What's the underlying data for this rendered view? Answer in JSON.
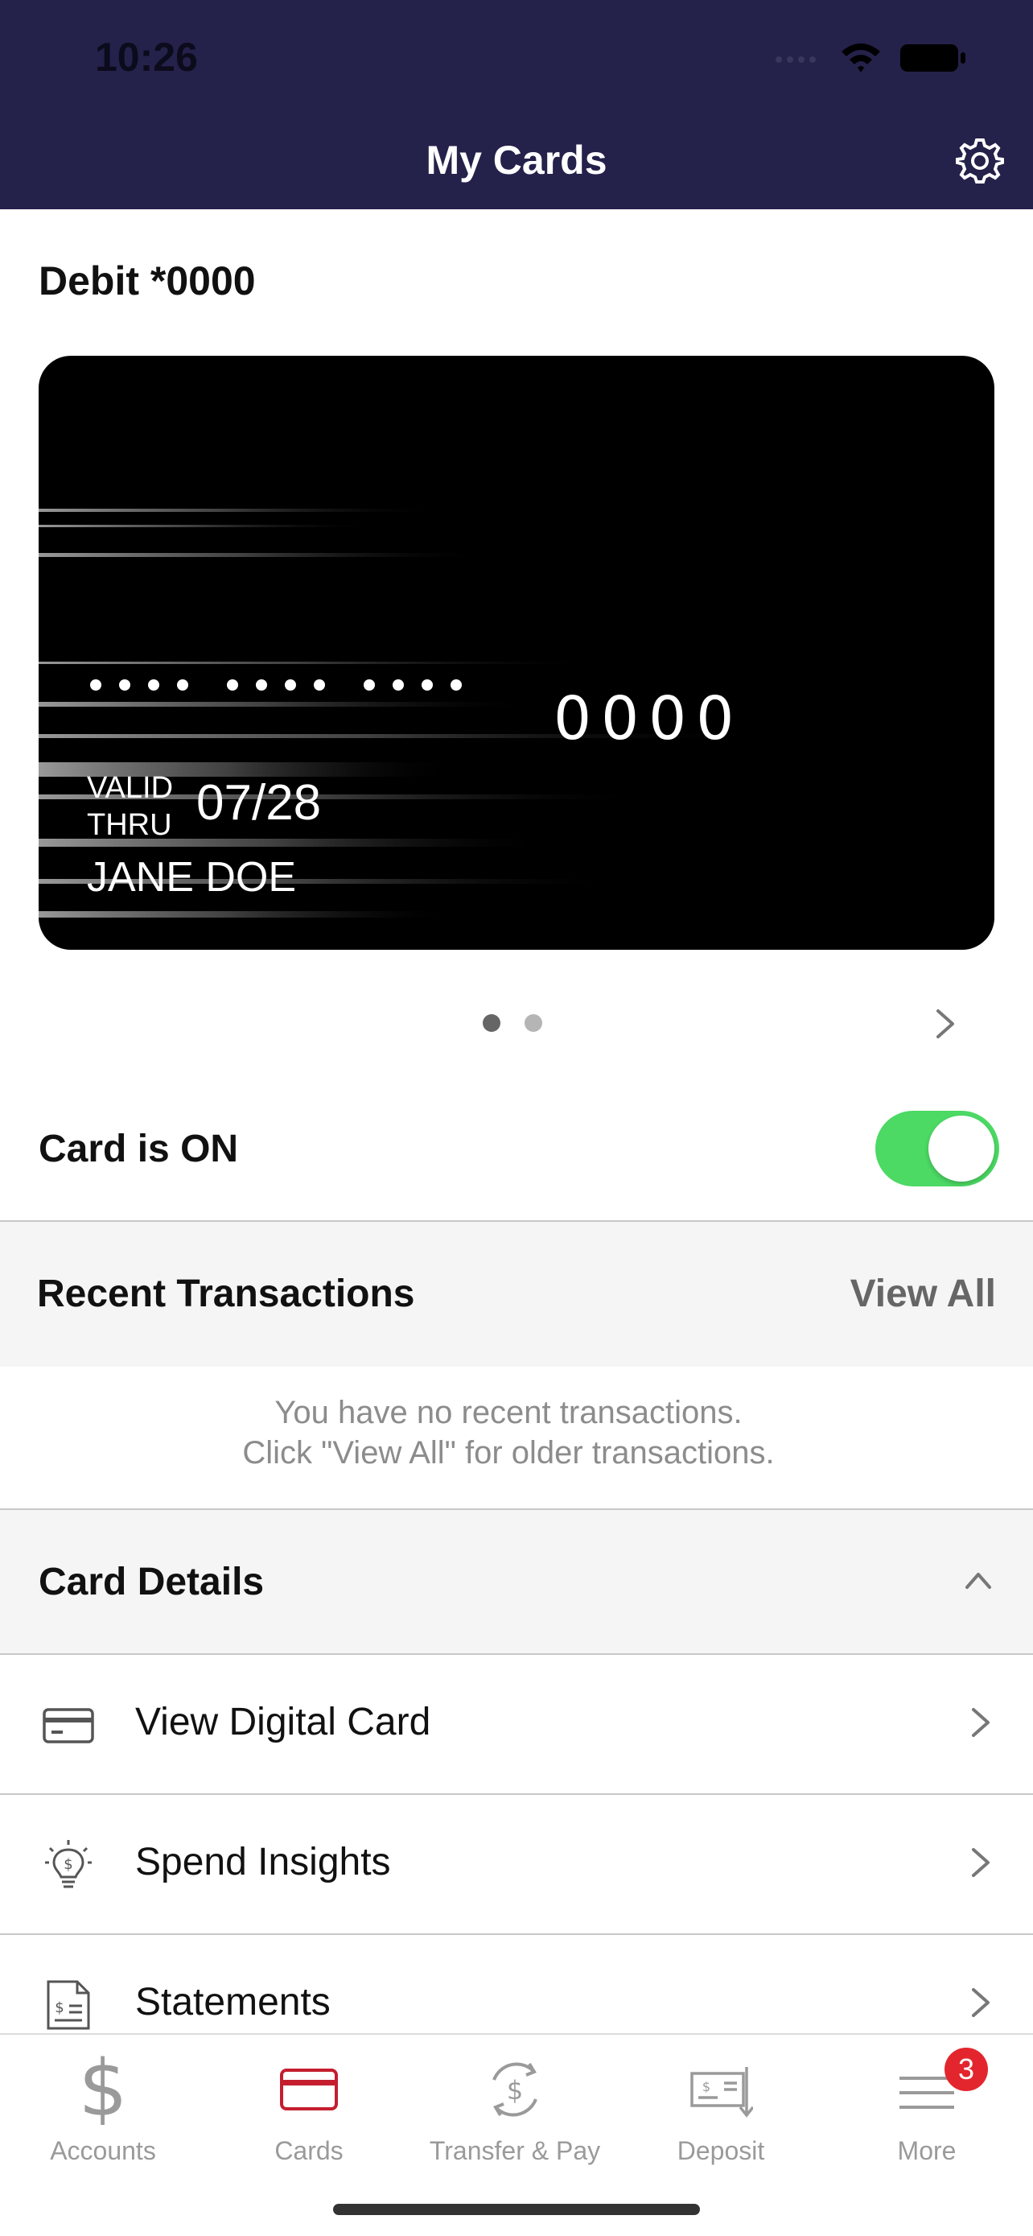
{
  "status_bar": {
    "time": "10:26"
  },
  "header": {
    "title": "My Cards"
  },
  "card": {
    "label": "Debit *0000",
    "last4": "0000",
    "valid_line1": "VALID",
    "valid_line2": "THRU",
    "expiry": "07/28",
    "holder": "JANE DOE",
    "page_count": 2,
    "active_page": 1
  },
  "card_toggle": {
    "label": "Card is ON",
    "on": true
  },
  "transactions": {
    "title": "Recent Transactions",
    "view_all": "View All",
    "empty_line1": "You have no recent transactions.",
    "empty_line2": "Click \"View All\" for older transactions."
  },
  "card_details": {
    "title": "Card Details",
    "items": [
      {
        "label": "View Digital Card",
        "icon": "card-icon"
      },
      {
        "label": "Spend Insights",
        "icon": "lightbulb-dollar-icon"
      },
      {
        "label": "Statements",
        "icon": "statement-icon"
      }
    ]
  },
  "tabs": [
    {
      "label": "Accounts",
      "icon": "dollar-icon",
      "active": false
    },
    {
      "label": "Cards",
      "icon": "card-icon",
      "active": true
    },
    {
      "label": "Transfer & Pay",
      "icon": "transfer-icon",
      "active": false
    },
    {
      "label": "Deposit",
      "icon": "check-deposit-icon",
      "active": false
    },
    {
      "label": "More",
      "icon": "menu-icon",
      "active": false,
      "badge": "3"
    }
  ],
  "colors": {
    "header": "#24214a",
    "accent": "#c41e2e",
    "toggle_on": "#4cd964",
    "badge": "#e3262d"
  }
}
